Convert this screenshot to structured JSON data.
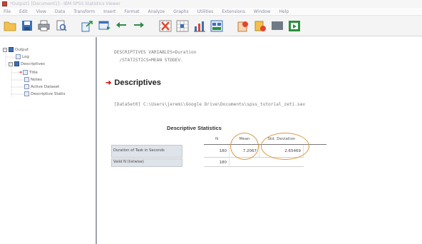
{
  "window": {
    "title": "*Output1 [Document1] - IBM SPSS Statistics Viewer"
  },
  "menu": {
    "items": [
      "File",
      "Edit",
      "View",
      "Data",
      "Transform",
      "Insert",
      "Format",
      "Analyze",
      "Graphs",
      "Utilities",
      "Extensions",
      "Window",
      "Help"
    ]
  },
  "toolbar": {
    "buttons": [
      "open-icon",
      "save-icon",
      "print-icon",
      "print-preview-icon",
      "export-icon",
      "recall-dialog-icon",
      "undo-icon",
      "redo-icon",
      "goto-data-icon",
      "goto-case-icon",
      "variables-icon",
      "designate-window-icon",
      "show-hide-icon",
      "collapse-icon",
      "insert-heading-icon",
      "insert-title-icon"
    ]
  },
  "nav": {
    "items": [
      {
        "label": "Output",
        "icon": "book-icon",
        "level": 0
      },
      {
        "label": "Log",
        "icon": "log-icon",
        "level": 1
      },
      {
        "label": "Descriptives",
        "icon": "book-icon",
        "level": 1
      },
      {
        "label": "Title",
        "icon": "title-icon",
        "level": 2
      },
      {
        "label": "Notes",
        "icon": "notes-icon",
        "level": 2
      },
      {
        "label": "Active Dataset",
        "icon": "dataset-icon",
        "level": 2
      },
      {
        "label": "Descriptive Statis",
        "icon": "table-icon",
        "level": 2
      }
    ]
  },
  "syntax": {
    "line1": "DESCRIPTIVES VARIABLES=Duration",
    "line2": "  /STATISTICS=MEAN STDDEV."
  },
  "section": {
    "title": "Descriptives"
  },
  "dataset_line": "[DataSet0] C:\\Users\\jeremi\\Google Drive\\Documents\\spss_tutorial_zeti.sav",
  "table": {
    "title": "Descriptive Statistics",
    "columns": [
      "N",
      "Mean",
      "Std. Deviation"
    ],
    "rows": [
      {
        "label": "Duration of Task in Seconds",
        "n": "180",
        "mean": "7.2067",
        "sd": "2.65469"
      },
      {
        "label": "Valid N (listwise)",
        "n": "180",
        "mean": "",
        "sd": ""
      }
    ]
  },
  "colors": {
    "accent_red": "#d81818",
    "annotation_circle": "#d8973f"
  }
}
